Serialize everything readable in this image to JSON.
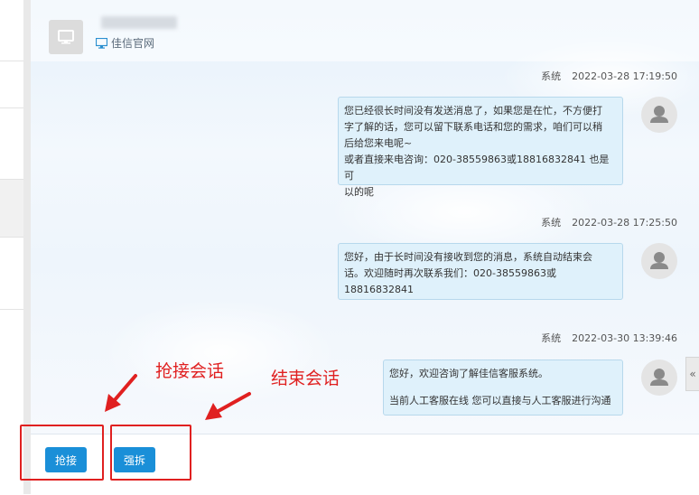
{
  "header": {
    "site_label": "佳信官网"
  },
  "messages": [
    {
      "sender": "系统",
      "time": "2022-03-28 17:19:50",
      "lines": [
        "您已经很长时间没有发送消息了，如果您是在忙，不方便打",
        "字了解的话，您可以留下联系电话和您的需求，咱们可以稍",
        "后给您来电呢~",
        "或者直接来电咨询：020-38559863或18816832841 也是可",
        "以的呢"
      ]
    },
    {
      "sender": "系统",
      "time": "2022-03-28 17:25:50",
      "lines": [
        "您好，由于长时间没有接收到您的消息，系统自动结束会",
        "话。欢迎随时再次联系我们：020-38559863或",
        "18816832841"
      ]
    },
    {
      "sender": "系统",
      "time": "2022-03-30 13:39:46",
      "lines": [
        "您好，欢迎咨询了解佳信客服系统。",
        "",
        "当前人工客服在线 您可以直接与人工客服进行沟通"
      ]
    }
  ],
  "toolbar": {
    "grab_label": "抢接",
    "force_label": "强拆"
  },
  "annotations": {
    "grab": "抢接会话",
    "end": "结束会话"
  },
  "collapse_glyph": "«",
  "colors": {
    "button": "#1a8fd8",
    "annotation": "#e02020",
    "bubble": "#dff1fb"
  }
}
